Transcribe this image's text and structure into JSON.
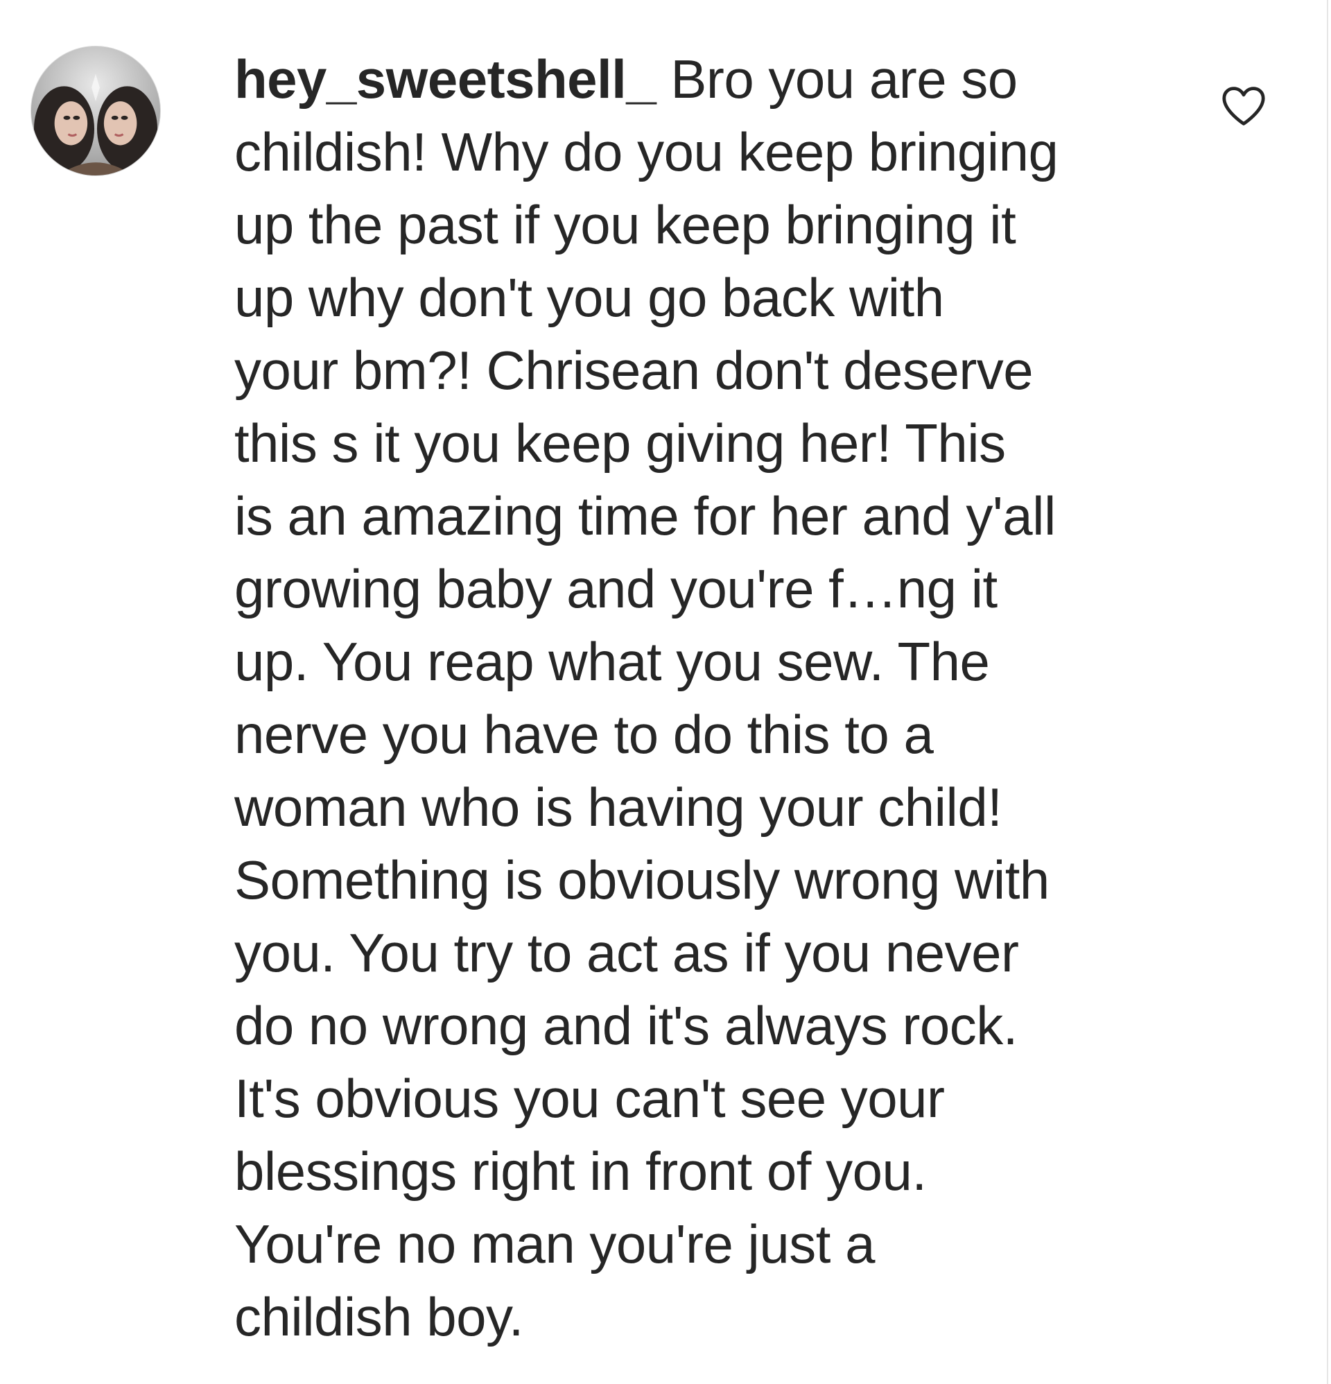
{
  "comment": {
    "username": "hey_sweetshell_",
    "first_line_text": " Bro you are so",
    "lines": [
      "childish! Why do you keep bringing",
      "up the past if you keep bringing it",
      "up why don't you go back with",
      "your bm?! Chrisean don't deserve",
      "this s  it you keep giving her! This",
      "is an amazing time for her and y'all",
      "growing baby and you're f…ng it",
      "up. You reap what you sew. The",
      "nerve you have to do this to a",
      "woman who is having your child!",
      "Something is obviously wrong with",
      "you. You try to act as if you never",
      "do no wrong and it's always rock.",
      "It's obvious you can't see your",
      "blessings right in front of you.",
      "You're no man you're just a",
      "childish boy."
    ]
  },
  "icons": {
    "avatar": "profile-avatar",
    "like": "heart-outline-icon"
  },
  "colors": {
    "text": "#262626",
    "icon": "#262626",
    "background": "#ffffff"
  }
}
